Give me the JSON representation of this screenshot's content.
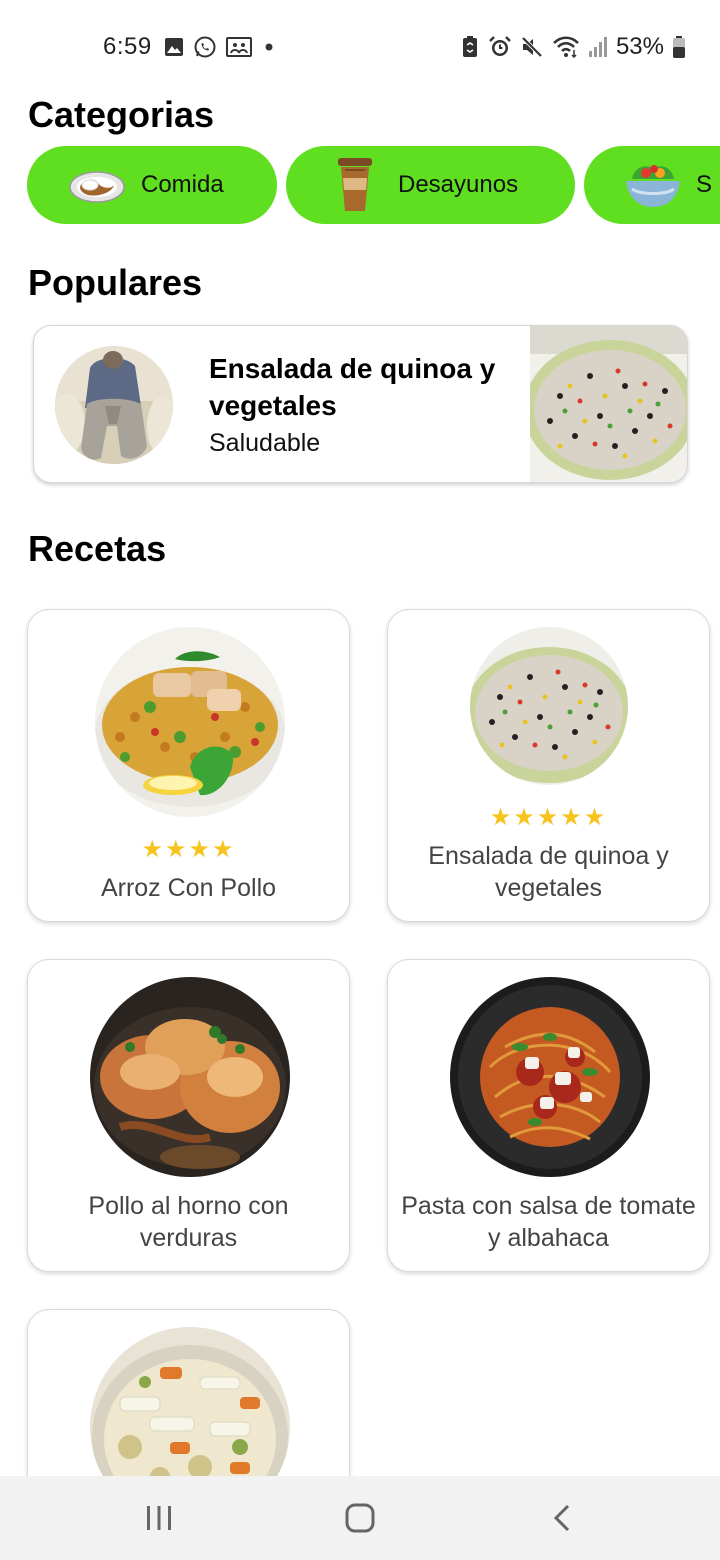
{
  "status_bar": {
    "time": "6:59",
    "left_icons": [
      "gallery-icon",
      "whatsapp-icon",
      "photo-frame-icon",
      "dot-icon"
    ],
    "right_icons": [
      "battery-saver-icon",
      "alarm-icon",
      "mute-icon",
      "wifi-icon",
      "signal-icon",
      "battery-icon"
    ],
    "battery": "53%"
  },
  "sections": {
    "categories_title": "Categorias",
    "popular_title": "Populares",
    "recipes_title": "Recetas"
  },
  "categories": [
    {
      "label": "Comida",
      "icon": "rice-plate-icon"
    },
    {
      "label": "Desayunos",
      "icon": "coffee-cup-icon"
    },
    {
      "label": "S",
      "icon": "salad-bowl-icon"
    }
  ],
  "popular": {
    "title": "Ensalada de quinoa y vegetales",
    "subtitle": "Saludable"
  },
  "recipes": [
    {
      "name": "Arroz Con Pollo",
      "rating": 4,
      "stars": "★★★★"
    },
    {
      "name": "Ensalada de quinoa y vegetales",
      "rating": 5,
      "stars": "★★★★★"
    },
    {
      "name": "Pollo al horno con verduras",
      "rating": 0,
      "stars": ""
    },
    {
      "name": "Pasta con salsa de tomate y albahaca",
      "rating": 0,
      "stars": ""
    },
    {
      "name": "",
      "rating": 0,
      "stars": ""
    }
  ],
  "colors": {
    "accent": "#5fdf1f",
    "star": "#f7c41f"
  },
  "nav": [
    "recent-apps-icon",
    "home-icon",
    "back-icon"
  ]
}
